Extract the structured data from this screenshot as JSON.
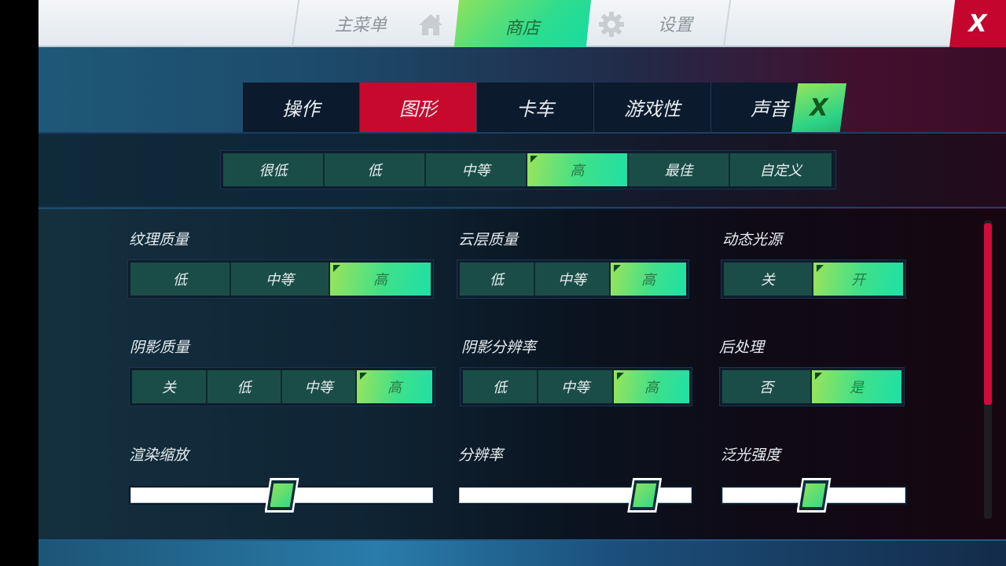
{
  "top_nav": {
    "items": [
      {
        "label": "主菜单",
        "icon": "home-icon",
        "active": false
      },
      {
        "label": "商店",
        "icon": null,
        "active": true
      },
      {
        "label": "设置",
        "icon": "gear-icon",
        "active": false
      }
    ],
    "close_label": "X"
  },
  "category_tabs": {
    "items": [
      {
        "label": "操作",
        "active": false
      },
      {
        "label": "图形",
        "active": true
      },
      {
        "label": "卡车",
        "active": false
      },
      {
        "label": "游戏性",
        "active": false
      },
      {
        "label": "声音",
        "active": false
      }
    ],
    "close_label": "X"
  },
  "presets": {
    "options": [
      "很低",
      "低",
      "中等",
      "高",
      "最佳",
      "自定义"
    ],
    "selected": "高"
  },
  "settings": {
    "texture_quality": {
      "label": "纹理质量",
      "options": [
        "低",
        "中等",
        "高"
      ],
      "selected": "高"
    },
    "cloud_quality": {
      "label": "云层质量",
      "options": [
        "低",
        "中等",
        "高"
      ],
      "selected": "高"
    },
    "dynamic_lights": {
      "label": "动态光源",
      "options": [
        "关",
        "开"
      ],
      "selected": "开"
    },
    "shadow_quality": {
      "label": "阴影质量",
      "options": [
        "关",
        "低",
        "中等",
        "高"
      ],
      "selected": "高"
    },
    "shadow_resolution": {
      "label": "阴影分辨率",
      "options": [
        "低",
        "中等",
        "高"
      ],
      "selected": "高"
    },
    "post_processing": {
      "label": "后处理",
      "options": [
        "否",
        "是"
      ],
      "selected": "是"
    },
    "render_scale": {
      "label": "渲染缩放",
      "value_pct": 50
    },
    "resolution": {
      "label": "分辨率",
      "value_pct": 80
    },
    "bloom_intensity": {
      "label": "泛光强度",
      "value_pct": 50
    }
  },
  "scrollbar": {
    "visible_fraction": 0.62,
    "position": 0
  },
  "colors": {
    "accent_green": "#2ddc8f",
    "accent_red": "#c8092e",
    "segment_bg": "#1b4d48"
  }
}
